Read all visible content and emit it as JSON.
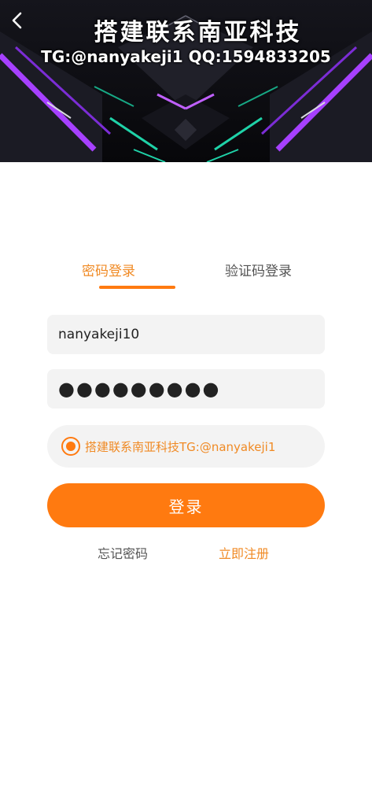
{
  "banner": {
    "title": "搭建联系南亚科技",
    "contact": "TG:@nanyakeji1 QQ:1594833205"
  },
  "tabs": {
    "password_login": "密码登录",
    "code_login": "验证码登录"
  },
  "form": {
    "username_value": "nanyakeji10",
    "password_masked": "●●●●●●●●●"
  },
  "agreement": {
    "text": "搭建联系南亚科技TG:@nanyakeji1",
    "checked": true
  },
  "actions": {
    "login_label": "登录",
    "forgot_password_label": "忘记密码",
    "register_label": "立即注册"
  },
  "colors": {
    "accent": "#ff7a10",
    "accent_text": "#f08a24",
    "field_bg": "#f3f3f3",
    "muted_text": "#555555"
  },
  "icons": {
    "back": "chevron-left-icon",
    "radio": "radio-checked-icon"
  }
}
